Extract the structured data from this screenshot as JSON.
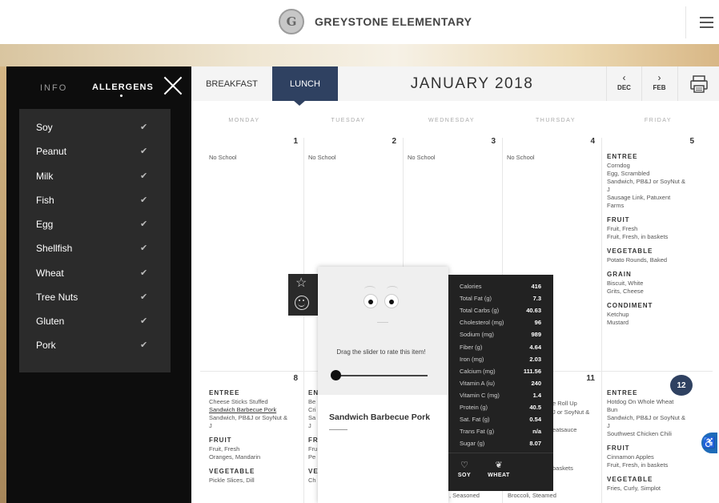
{
  "header": {
    "logo_letter": "G",
    "school_name": "GREYSTONE ELEMENTARY"
  },
  "sidebar": {
    "tab_info": "INFO",
    "tab_allergens": "ALLERGENS",
    "allergens": [
      {
        "label": "Soy",
        "check": "✔"
      },
      {
        "label": "Peanut",
        "check": "✔"
      },
      {
        "label": "Milk",
        "check": "✔"
      },
      {
        "label": "Fish",
        "check": "✔"
      },
      {
        "label": "Egg",
        "check": "✔"
      },
      {
        "label": "Shellfish",
        "check": "✔"
      },
      {
        "label": "Wheat",
        "check": "✔"
      },
      {
        "label": "Tree Nuts",
        "check": "✔"
      },
      {
        "label": "Gluten",
        "check": "✔"
      },
      {
        "label": "Pork",
        "check": "✔"
      }
    ]
  },
  "calendar": {
    "breakfast_label": "BREAKFAST",
    "lunch_label": "LUNCH",
    "month_title": "JANUARY 2018",
    "prev_arrow": "‹",
    "prev_label": "DEC",
    "next_arrow": "›",
    "next_label": "FEB",
    "weekdays": [
      "MONDAY",
      "TUESDAY",
      "WEDNESDAY",
      "THURSDAY",
      "FRIDAY"
    ],
    "week1": {
      "days": [
        "1",
        "2",
        "3",
        "4",
        "5"
      ],
      "no_school": "No School"
    },
    "week2": {
      "days": [
        "8",
        "11",
        "12"
      ]
    },
    "friday5": {
      "cat_entree": "ENTREE",
      "entree": [
        "Corndog",
        "Egg, Scrambled",
        "Sandwich, PB&J or SoyNut &",
        "J",
        "Sausage Link, Patuxent",
        "Farms"
      ],
      "cat_fruit": "FRUIT",
      "fruit": [
        "Fruit, Fresh",
        "Fruit, Fresh, in baskets"
      ],
      "cat_vegetable": "VEGETABLE",
      "vegetable": [
        "Potato Rounds, Baked"
      ],
      "cat_grain": "GRAIN",
      "grain": [
        "Biscuit, White",
        "Grits, Cheese"
      ],
      "cat_condiment": "CONDIMENT",
      "condiment": [
        "Ketchup",
        "Mustard"
      ]
    },
    "monday8": {
      "cat_entree": "ENTREE",
      "entree": [
        "Cheese Sticks Stuffed",
        "Sandwich Barbecue Pork",
        "Sandwich, PB&J or SoyNut &",
        "J"
      ],
      "cat_fruit": "FRUIT",
      "fruit": [
        "Fruit, Fresh",
        "Oranges, Mandarin"
      ],
      "cat_vegetable": "VEGETABLE",
      "vegetable": [
        "Pickle Slices, Dill"
      ]
    },
    "tuesday9": {
      "cat_entree": "EN",
      "entree": [
        "Be",
        "Cri",
        "Sa",
        "J"
      ],
      "cat_fruit": "FR",
      "fruit": [
        "Fru",
        "Pe"
      ],
      "cat_vegetable": "VE",
      "vegetable": [
        "Ch"
      ]
    },
    "thursday11": {
      "entree": [
        "e Roll Up",
        "J or SoyNut &",
        "eatsauce"
      ],
      "fruit": [
        "baskets"
      ],
      "vegetable": [
        "Broccoli, Steamed"
      ]
    },
    "wednesday10": {
      "vegetable": [
        ", Seasoned"
      ]
    },
    "friday12": {
      "cat_entree": "ENTREE",
      "entree": [
        "Hotdog On Whole Wheat",
        "Bun",
        "Sandwich, PB&J or SoyNut &",
        "J",
        "Southwest Chicken Chili"
      ],
      "cat_fruit": "FRUIT",
      "fruit": [
        "Cinnamon Apples",
        "Fruit, Fresh, in baskets"
      ],
      "cat_vegetable": "VEGETABLE",
      "vegetable": [
        "Fries, Curly, Simplot"
      ]
    }
  },
  "popup": {
    "rate_text": "Drag the slider to rate this item!",
    "rating_value": 0,
    "item_name": "Sandwich Barbecue Pork",
    "nutrition": [
      {
        "label": "Calories",
        "value": "416"
      },
      {
        "label": "Total Fat (g)",
        "value": "7.3"
      },
      {
        "label": "Total Carbs (g)",
        "value": "40.63"
      },
      {
        "label": "Cholesterol (mg)",
        "value": "96"
      },
      {
        "label": "Sodium (mg)",
        "value": "989"
      },
      {
        "label": "Fiber (g)",
        "value": "4.64"
      },
      {
        "label": "Iron (mg)",
        "value": "2.03"
      },
      {
        "label": "Calcium (mg)",
        "value": "111.56"
      },
      {
        "label": "Vitamin A (iu)",
        "value": "240"
      },
      {
        "label": "Vitamin C (mg)",
        "value": "1.4"
      },
      {
        "label": "Protein (g)",
        "value": "40.5"
      },
      {
        "label": "Sat. Fat (g)",
        "value": "0.54"
      },
      {
        "label": "Trans Fat (g)",
        "value": "n/a"
      },
      {
        "label": "Sugar (g)",
        "value": "8.07"
      }
    ],
    "allergens": [
      {
        "icon": "soy-icon",
        "label": "SOY"
      },
      {
        "icon": "wheat-icon",
        "label": "WHEAT"
      }
    ]
  },
  "colors": {
    "lunch_tab": "#2f4161",
    "sidebar_bg": "#0d0d0d",
    "allergen_panel": "#2b2b2b",
    "nutrition_bg": "#222222",
    "accessibility": "#1e6bb8"
  }
}
